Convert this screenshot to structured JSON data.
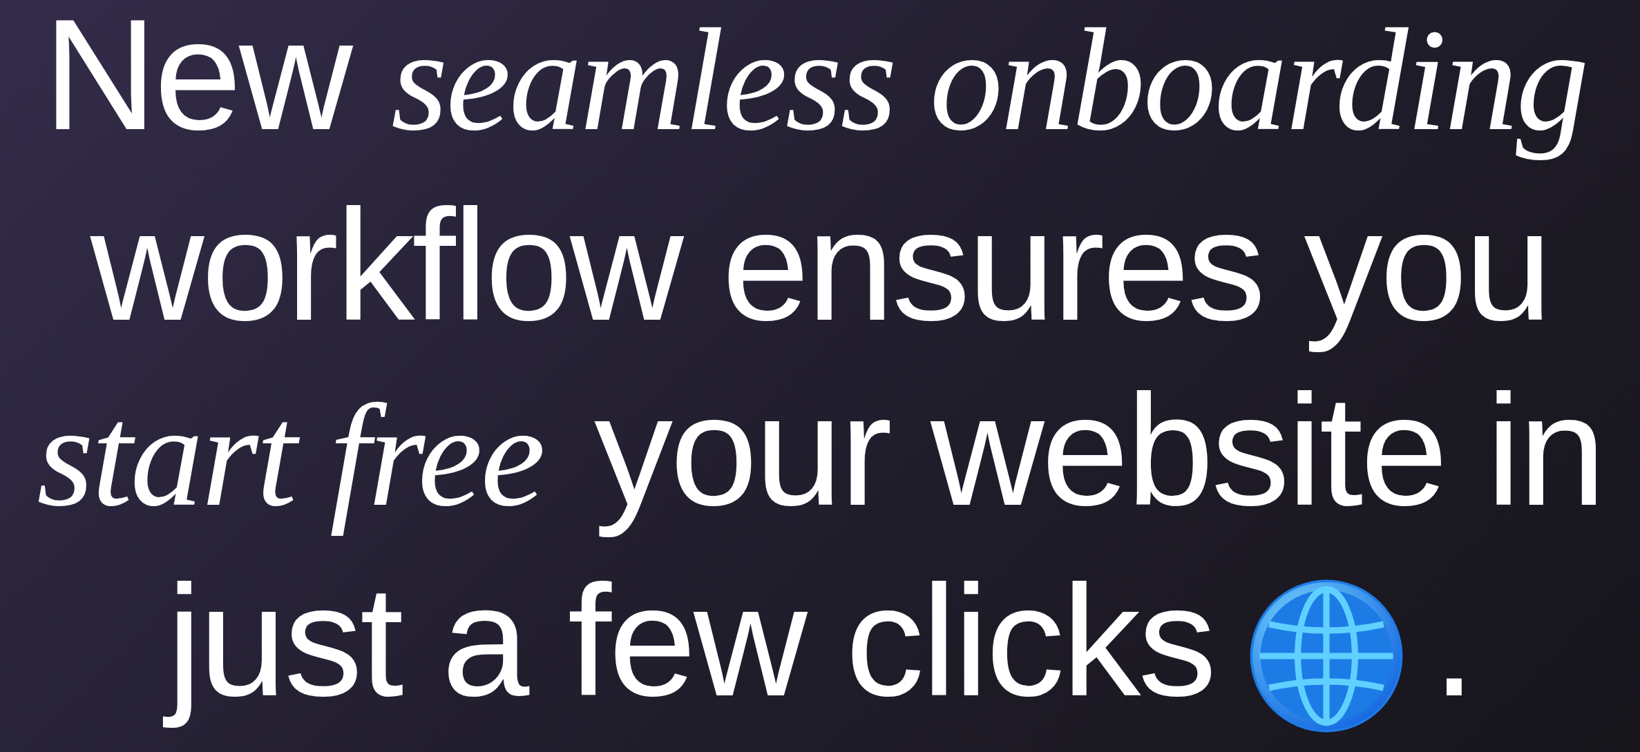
{
  "headline": {
    "lines": [
      "New *seamless onboarding*",
      "workflow ensures you",
      "*start free* your website in",
      "just a few clicks"
    ],
    "end": "."
  }
}
